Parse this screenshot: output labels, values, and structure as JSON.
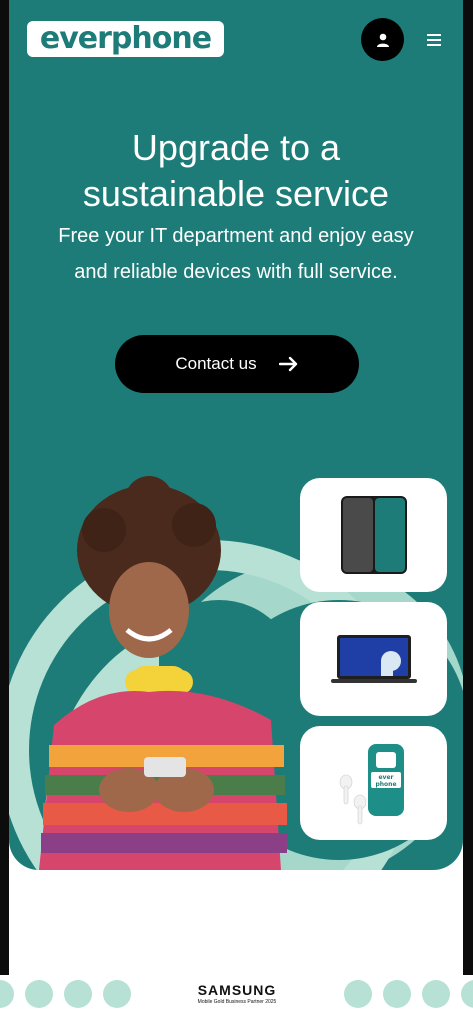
{
  "header": {
    "logo_text": "everphone",
    "account_icon": "user-icon",
    "menu_icon": "hamburger-menu-icon"
  },
  "hero": {
    "title_line1": "Upgrade to a",
    "title_line2": "sustainable service",
    "subtitle_line1": "Free your IT department and enjoy easy",
    "subtitle_line2": "and reliable devices with full service.",
    "cta_label": "Contact us",
    "cta_icon": "arrow-right-icon"
  },
  "product_cards": [
    {
      "name": "smartphone",
      "icon": "smartphone-icon"
    },
    {
      "name": "laptop",
      "icon": "laptop-icon"
    },
    {
      "name": "earbuds-and-case",
      "icon": "earbuds-icon",
      "case_text": "ever phone"
    }
  ],
  "footer": {
    "partner_brand": "SAMSUNG",
    "partner_caption": "Mobile Gold Business Partner 2025"
  },
  "colors": {
    "brand_teal": "#1d7c78",
    "light_mint": "#b6e1d4",
    "cta_black": "#000000",
    "white": "#ffffff"
  }
}
